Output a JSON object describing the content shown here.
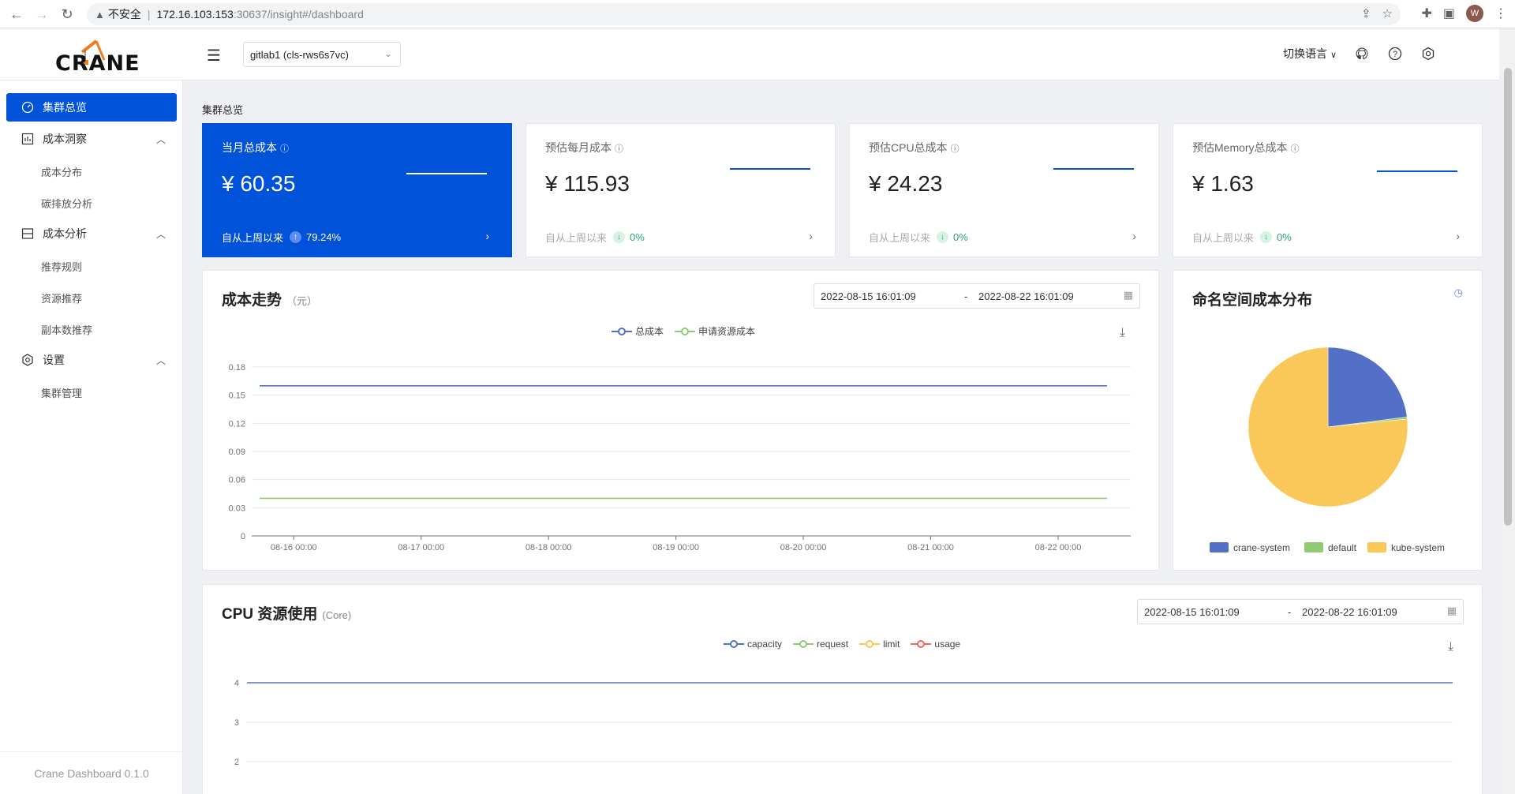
{
  "browser": {
    "insecure_label": "不安全",
    "url_host": "172.16.103.153",
    "url_path": ":30637/insight#/dashboard",
    "avatar_letter": "W"
  },
  "header": {
    "logo_text": "CRANE",
    "cluster_value": "gitlab1 (cls-rws6s7vc)",
    "language_label": "切换语言"
  },
  "sidebar": {
    "items": [
      {
        "label": "集群总览",
        "icon": "dashboard-icon",
        "active": true
      },
      {
        "label": "成本洞察",
        "icon": "chart-icon"
      },
      {
        "label": "成本分布"
      },
      {
        "label": "碳排放分析"
      },
      {
        "label": "成本分析",
        "icon": "list-icon"
      },
      {
        "label": "推荐规则"
      },
      {
        "label": "资源推荐"
      },
      {
        "label": "副本数推荐"
      },
      {
        "label": "设置",
        "icon": "gear-icon"
      },
      {
        "label": "集群管理"
      }
    ],
    "footer": "Crane Dashboard 0.1.0"
  },
  "page_title": "集群总览",
  "kpis": [
    {
      "title": "当月总成本",
      "value": "¥ 60.35",
      "foot": "自从上周以来",
      "pct": "79.24%",
      "trend": "up"
    },
    {
      "title": "预估每月成本",
      "value": "¥ 115.93",
      "foot": "自从上周以来",
      "pct": "0%",
      "trend": "down"
    },
    {
      "title": "预估CPU总成本",
      "value": "¥ 24.23",
      "foot": "自从上周以来",
      "pct": "0%",
      "trend": "down"
    },
    {
      "title": "预估Memory总成本",
      "value": "¥ 1.63",
      "foot": "自从上周以来",
      "pct": "0%",
      "trend": "down"
    }
  ],
  "cost_trend": {
    "title": "成本走势",
    "unit": "（元）",
    "date_start": "2022-08-15 16:01:09",
    "date_sep": "-",
    "date_end": "2022-08-22 16:01:09"
  },
  "namespace_cost": {
    "title": "命名空间成本分布"
  },
  "cpu_usage": {
    "title": "CPU 资源使用",
    "unit": "(Core)",
    "date_start": "2022-08-15 16:01:09",
    "date_sep": "-",
    "date_end": "2022-08-22 16:01:09"
  },
  "colors": {
    "primary": "#0052d9",
    "success": "#2ba471",
    "series_blue": "#5470c6",
    "series_green": "#91cc75",
    "series_yellow": "#fac858",
    "series_red": "#ee6666"
  },
  "chart_data": [
    {
      "type": "line",
      "x_ticks": [
        "08-16 00:00",
        "08-17 00:00",
        "08-18 00:00",
        "08-19 00:00",
        "08-20 00:00",
        "08-21 00:00",
        "08-22 00:00"
      ],
      "ylim": [
        0,
        0.18
      ],
      "y_ticks": [
        "0",
        "0.03",
        "0.06",
        "0.09",
        "0.12",
        "0.15",
        "0.18"
      ],
      "series": [
        {
          "name": "总成本",
          "color": "#5470c6",
          "values": [
            0.16,
            0.16
          ]
        },
        {
          "name": "申请资源成本",
          "color": "#91cc75",
          "values": [
            0.04,
            0.04
          ]
        }
      ]
    },
    {
      "type": "pie",
      "slices": [
        {
          "name": "crane-system",
          "color": "#5470c6",
          "value": 0.23
        },
        {
          "name": "default",
          "color": "#91cc75",
          "value": 0.004
        },
        {
          "name": "kube-system",
          "color": "#fac858",
          "value": 0.766
        }
      ]
    },
    {
      "type": "line",
      "y_ticks": [
        "2",
        "3",
        "4"
      ],
      "ylim": [
        2,
        4
      ],
      "series": [
        {
          "name": "capacity",
          "color": "#5470c6",
          "values": [
            4,
            4
          ]
        },
        {
          "name": "request",
          "color": "#91cc75",
          "values": []
        },
        {
          "name": "limit",
          "color": "#fac858",
          "values": []
        },
        {
          "name": "usage",
          "color": "#ee6666",
          "values": []
        }
      ]
    }
  ]
}
